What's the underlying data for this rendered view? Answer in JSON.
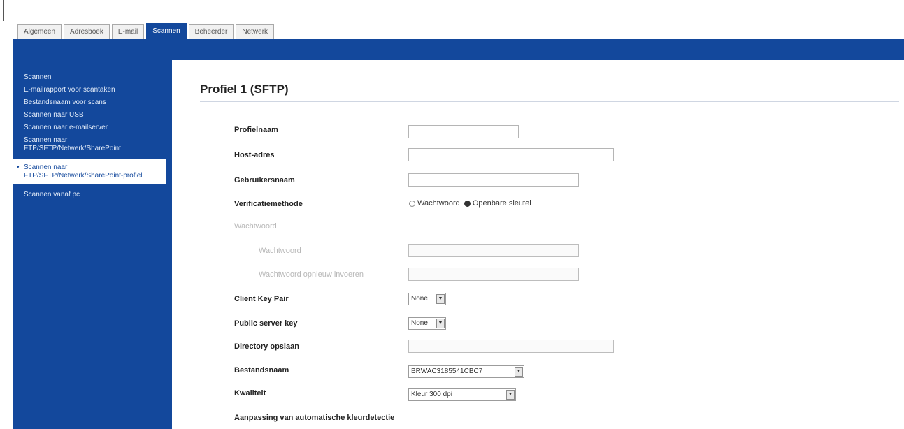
{
  "tabs": [
    {
      "label": "Algemeen",
      "active": false
    },
    {
      "label": "Adresboek",
      "active": false
    },
    {
      "label": "E-mail",
      "active": false
    },
    {
      "label": "Scannen",
      "active": true
    },
    {
      "label": "Beheerder",
      "active": false
    },
    {
      "label": "Netwerk",
      "active": false
    }
  ],
  "sidebar": {
    "items": [
      {
        "label": "Scannen"
      },
      {
        "label": "E-mailrapport voor scantaken"
      },
      {
        "label": "Bestandsnaam voor scans"
      },
      {
        "label": "Scannen naar USB"
      },
      {
        "label": "Scannen naar e-mailserver"
      },
      {
        "label": "Scannen naar FTP/SFTP/Netwerk/SharePoint"
      },
      {
        "label": "Scannen naar FTP/SFTP/Netwerk/SharePoint-profiel",
        "active": true
      },
      {
        "label": "Scannen vanaf pc"
      }
    ]
  },
  "form": {
    "title": "Profiel 1 (SFTP)",
    "profile_name_label": "Profielnaam",
    "profile_name_value": "",
    "host_label": "Host-adres",
    "host_value": "",
    "username_label": "Gebruikersnaam",
    "username_value": "",
    "auth_label": "Verificatiemethode",
    "auth_option_password": "Wachtwoord",
    "auth_option_key": "Openbare sleutel",
    "auth_selected": "Openbare sleutel",
    "password_section_label": "Wachtwoord",
    "password_label": "Wachtwoord",
    "password_confirm_label": "Wachtwoord opnieuw invoeren",
    "client_key_label": "Client Key Pair",
    "client_key_value": "None",
    "public_key_label": "Public server key",
    "public_key_value": "None",
    "directory_label": "Directory opslaan",
    "directory_value": "",
    "filename_label": "Bestandsnaam",
    "filename_value": "BRWAC3185541CBC7",
    "quality_label": "Kwaliteit",
    "quality_value": "Kleur 300 dpi",
    "auto_color_label": "Aanpassing van automatische kleurdetectie"
  },
  "colors": {
    "accent": "#13489c",
    "tab_bg": "#f1f1f1"
  }
}
